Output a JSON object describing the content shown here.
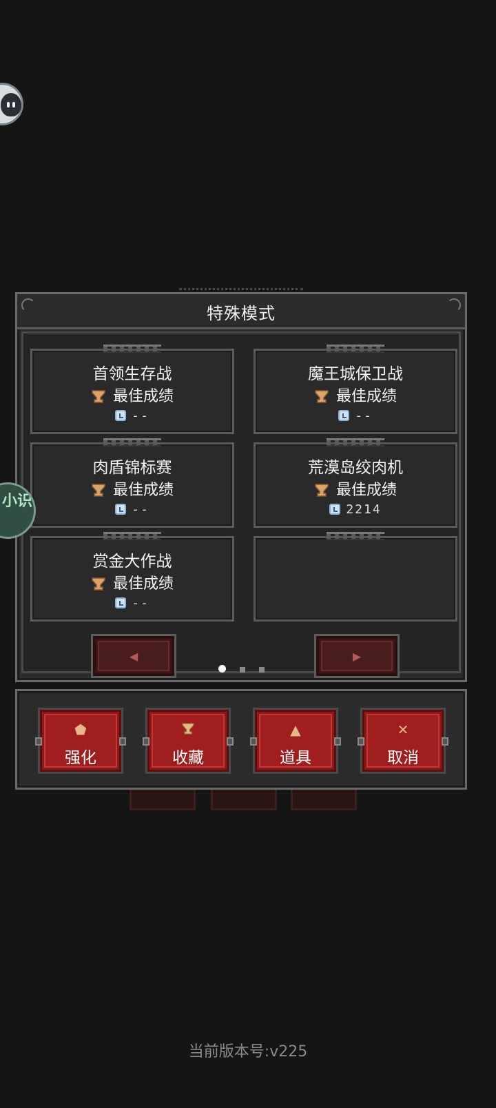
{
  "dialog": {
    "title": "特殊模式",
    "modes": [
      {
        "name": "首领生存战",
        "best_label": "最佳成绩",
        "score": "--"
      },
      {
        "name": "魔王城保卫战",
        "best_label": "最佳成绩",
        "score": "--"
      },
      {
        "name": "肉盾锦标赛",
        "best_label": "最佳成绩",
        "score": "--"
      },
      {
        "name": "荒漠岛绞肉机",
        "best_label": "最佳成绩",
        "score": "2214"
      },
      {
        "name": "赏金大作战",
        "best_label": "最佳成绩",
        "score": "--"
      }
    ],
    "prev_arrow": "◀",
    "next_arrow": "▶",
    "page_indicator": {
      "current": 1,
      "total": 3
    }
  },
  "toolbar": {
    "buttons": [
      {
        "label": "强化",
        "icon": "upgrade-icon",
        "glyph": "⬟"
      },
      {
        "label": "收藏",
        "icon": "trophy-icon",
        "glyph": "⌂"
      },
      {
        "label": "道具",
        "icon": "potion-icon",
        "glyph": "▲"
      },
      {
        "label": "取消",
        "icon": "close-icon",
        "glyph": "✕"
      }
    ]
  },
  "side_widget": {
    "text": "小识"
  },
  "footer": {
    "version": "当前版本号:v225"
  },
  "colors": {
    "background": "#151515",
    "panel": "#2b2b2b",
    "button_red": "#a01e1e",
    "trophy": "#e3b98a",
    "clock": "#cfe2f3"
  }
}
